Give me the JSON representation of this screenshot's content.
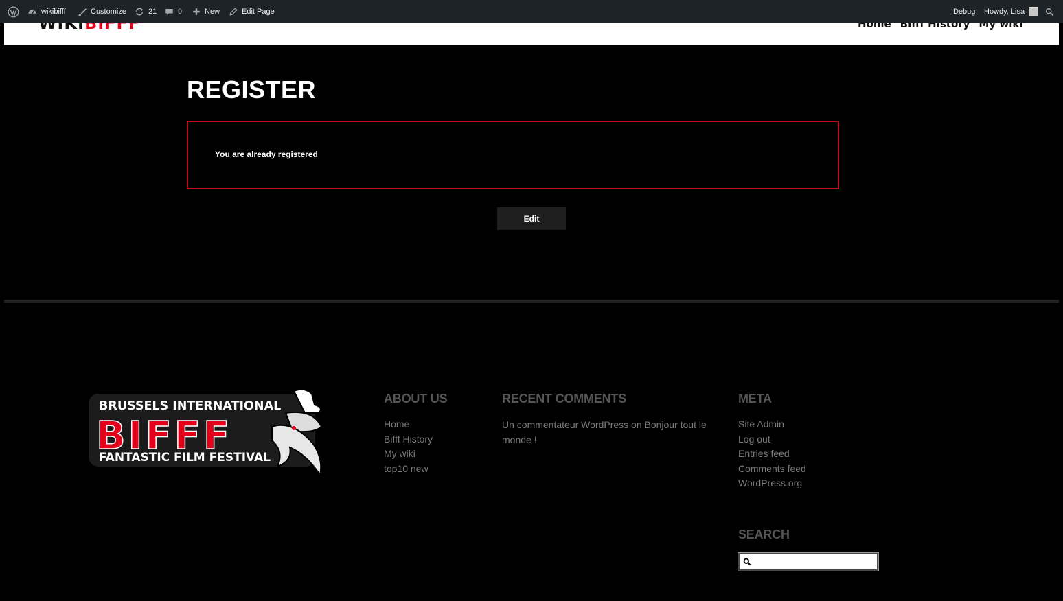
{
  "admin_bar": {
    "site_name": "wikibifff",
    "customize": "Customize",
    "updates_count": "21",
    "comments_count": "0",
    "new_label": "New",
    "edit_page": "Edit Page",
    "debug": "Debug",
    "howdy": "Howdy, Lisa"
  },
  "header": {
    "logo_left": "WIKI",
    "logo_right": "BIFFF",
    "nav": [
      "Home",
      "Bifff History",
      "My wiki"
    ]
  },
  "main": {
    "title": "REGISTER",
    "notice": "You are already registered",
    "edit_button": "Edit"
  },
  "footer": {
    "logo": {
      "line1": "BRUSSELS INTERNATIONAL",
      "line2": "BIFFF",
      "line3": "FANTASTIC FILM FESTIVAL"
    },
    "about": {
      "title": "ABOUT US",
      "items": [
        "Home",
        "Bifff History",
        "My wiki",
        "top10 new"
      ]
    },
    "recent_comments": {
      "title": "RECENT COMMENTS",
      "text": "Un commentateur WordPress on Bonjour tout le monde !"
    },
    "meta": {
      "title": "META",
      "items": [
        "Site Admin",
        "Log out",
        "Entries feed",
        "Comments feed",
        "WordPress.org"
      ]
    },
    "search": {
      "title": "SEARCH",
      "placeholder": ""
    }
  },
  "colors": {
    "accent_red": "#c0101c",
    "admin_bar_bg": "#1d2327",
    "footer_heading": "#555555",
    "footer_link": "#7a7a7a"
  },
  "icons": [
    "wordpress-logo-icon",
    "dashboard-icon",
    "brush-icon",
    "updates-icon",
    "comment-icon",
    "plus-icon",
    "pencil-icon",
    "avatar",
    "search-icon"
  ]
}
